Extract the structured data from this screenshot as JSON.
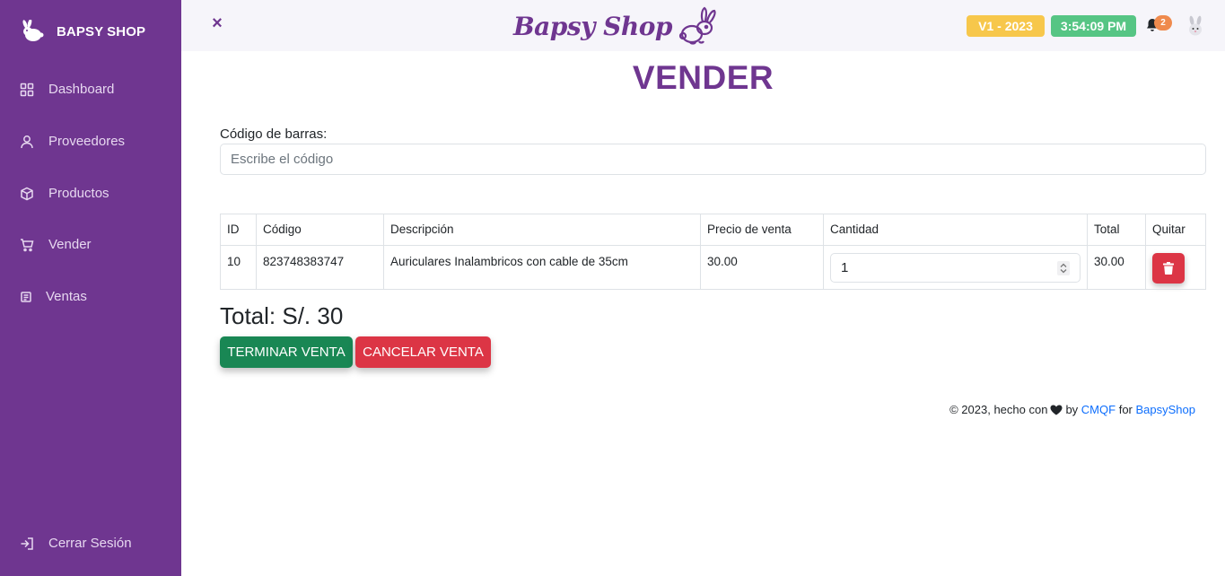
{
  "sidebar": {
    "brand": "BAPSY SHOP",
    "items": [
      {
        "label": "Dashboard",
        "icon": "grid-icon"
      },
      {
        "label": "Proveedores",
        "icon": "user-icon"
      },
      {
        "label": "Productos",
        "icon": "box-icon"
      },
      {
        "label": "Vender",
        "icon": "cart-icon"
      },
      {
        "label": "Ventas",
        "icon": "receipt-icon"
      }
    ],
    "logout": "Cerrar Sesión"
  },
  "header": {
    "close_icon": "×",
    "logo_text": "Bapsy Shop",
    "version": "V1 - 2023",
    "time": "3:54:09 PM",
    "notifications": "2",
    "colors": {
      "version": "#f7c74b",
      "time": "#56c584",
      "notifications": "#ef8a4d"
    }
  },
  "page": {
    "title": "VENDER",
    "barcode_label": "Código de barras:",
    "barcode_placeholder": "Escribe el código"
  },
  "table": {
    "headers": [
      "ID",
      "Código",
      "Descripción",
      "Precio de venta",
      "Cantidad",
      "Total",
      "Quitar"
    ],
    "rows": [
      {
        "id": "10",
        "code": "823748383747",
        "description": "Auriculares Inalambricos con cable de 35cm",
        "price": "30.00",
        "quantity": "1",
        "total": "30.00"
      }
    ]
  },
  "summary": {
    "total": "Total: S/. 30",
    "finish_label": "TERMINAR VENTA",
    "cancel_label": "CANCELAR VENTA"
  },
  "footer": {
    "prefix": "© 2023, hecho con",
    "by": "by",
    "author": "CMQF",
    "for": "for",
    "client": "BapsyShop"
  },
  "colors": {
    "brand": "#6f3690",
    "success": "#198754",
    "danger": "#dc3545",
    "link": "#0d6efd"
  }
}
